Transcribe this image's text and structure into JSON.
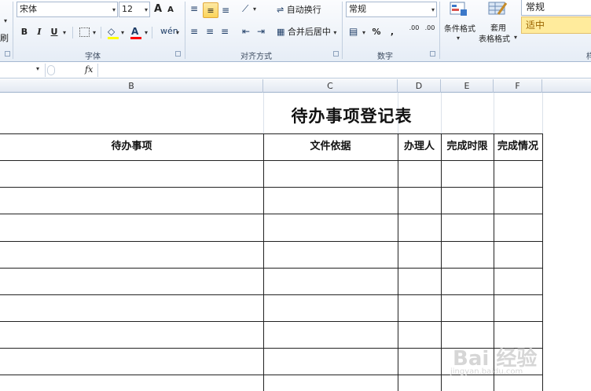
{
  "ribbon": {
    "clipboard": {
      "paste_label": "刷"
    },
    "font": {
      "font_name": "宋体",
      "font_size": "12",
      "grow_label": "A",
      "shrink_label": "A",
      "bold": "B",
      "italic": "I",
      "underline": "U",
      "fill_color": "#ffff00",
      "font_color": "#ff0000",
      "group_label": "字体"
    },
    "alignment": {
      "wrap_text_label": "自动换行",
      "merge_center_label": "合并后居中",
      "group_label": "对齐方式"
    },
    "number": {
      "format": "常规",
      "percent": "%",
      "comma": ",",
      "inc_decimal": ".00",
      "dec_decimal": ".00",
      "group_label": "数字"
    },
    "styles": {
      "conditional_label": "条件格式",
      "format_table_label_1": "套用",
      "format_table_label_2": "表格格式",
      "style_normal": "常规",
      "style_neutral": "适中",
      "partial_group_label": "样"
    }
  },
  "formula_bar": {
    "fx": "fx",
    "value": ""
  },
  "columns": [
    "B",
    "C",
    "D",
    "E",
    "F"
  ],
  "sheet": {
    "title": "待办事项登记表",
    "headers": [
      "待办事项",
      "文件依据",
      "办理人",
      "完成时限",
      "完成情况"
    ],
    "rows": 8
  },
  "watermark": {
    "text": "Bai 经验",
    "url": "jingyan.baidu.com"
  }
}
